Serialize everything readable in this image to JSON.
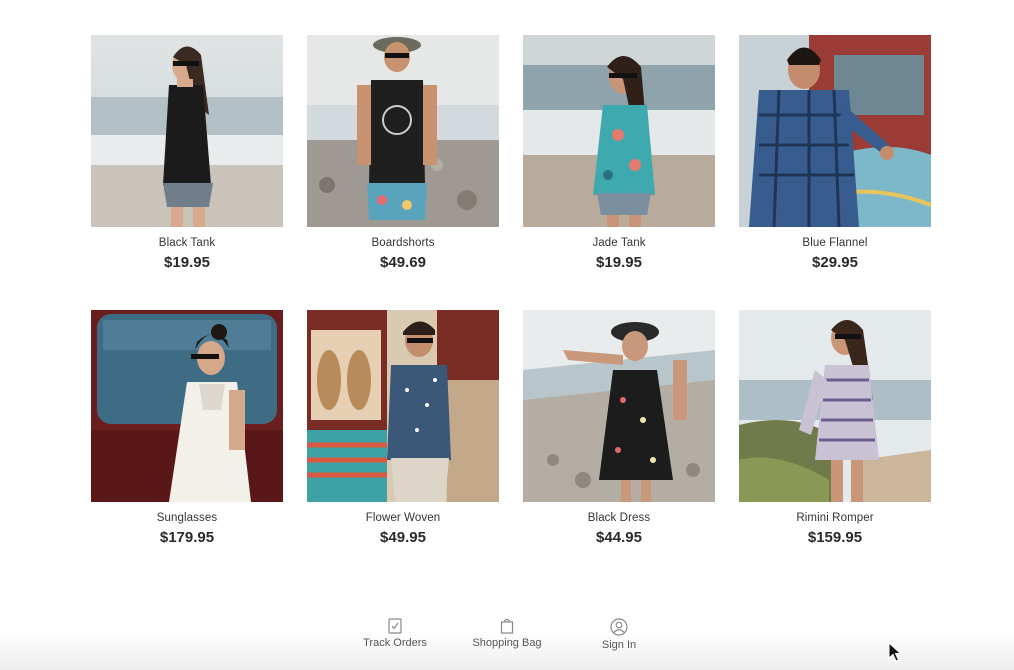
{
  "products": [
    {
      "name": "Black Tank",
      "price": "$19.95"
    },
    {
      "name": "Boardshorts",
      "price": "$49.69"
    },
    {
      "name": "Jade Tank",
      "price": "$19.95"
    },
    {
      "name": "Blue Flannel",
      "price": "$29.95"
    },
    {
      "name": "Sunglasses",
      "price": "$179.95"
    },
    {
      "name": "Flower Woven",
      "price": "$49.95"
    },
    {
      "name": "Black Dress",
      "price": "$44.95"
    },
    {
      "name": "Rimini Romper",
      "price": "$159.95"
    }
  ],
  "footer": {
    "track_orders": {
      "label": "Track Orders",
      "icon": "track-orders-icon"
    },
    "shopping_bag": {
      "label": "Shopping Bag",
      "icon": "shopping-bag-icon"
    },
    "sign_in": {
      "label": "Sign In",
      "icon": "user-icon"
    }
  }
}
